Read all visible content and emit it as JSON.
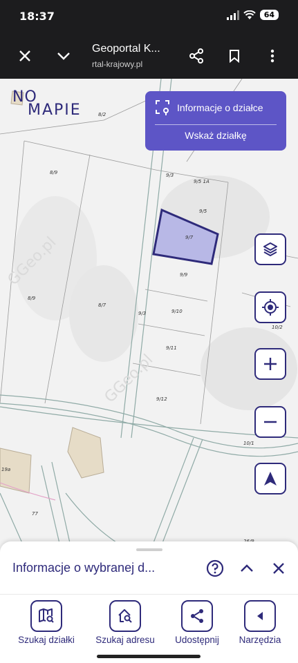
{
  "status_bar": {
    "time": "18:37",
    "battery": "64"
  },
  "browser": {
    "title": "Geoportal K...",
    "url": "rtal-krajowy.pl"
  },
  "logo": {
    "line1": "NO",
    "line2": "MAPIE"
  },
  "info_panel": {
    "parcel_info": "Informacje o działce",
    "show_parcel": "Wskaż działkę"
  },
  "parcel_labels": {
    "p8_2": "8/2",
    "p8_9": "8/9",
    "p9_3a": "9/3",
    "p9_5_1a": "9/5 1A",
    "p9_5": "9/5",
    "p9_7": "9/7",
    "p9_9": "9/9",
    "p8_9b": "8/9",
    "p8_7": "8/7",
    "p9_3b": "9/3",
    "p9_10": "9/10",
    "p10_2": "10/2",
    "p9_11": "9/11",
    "p9_12": "9/12",
    "p10_1": "10/1",
    "p19a": "19a",
    "p77": "77",
    "p26_9": "26/9"
  },
  "bottom_sheet": {
    "title": "Informacje o wybranej d..."
  },
  "nav": {
    "search_parcel": "Szukaj działki",
    "search_address": "Szukaj adresu",
    "share": "Udostępnij",
    "tools": "Narzędzia"
  },
  "colors": {
    "accent": "#2e2a7a",
    "panel": "#5d55c6",
    "selected_fill": "#b8b8e6"
  },
  "icons": [
    "close-icon",
    "chevron-down-icon",
    "share-icon",
    "bookmark-icon",
    "more-vert-icon",
    "layers-icon",
    "gps-icon",
    "zoom-in-icon",
    "zoom-out-icon",
    "navigation-arrow-icon",
    "help-icon",
    "chevron-up-icon",
    "map-search-icon",
    "home-search-icon",
    "back-arrow-icon"
  ]
}
